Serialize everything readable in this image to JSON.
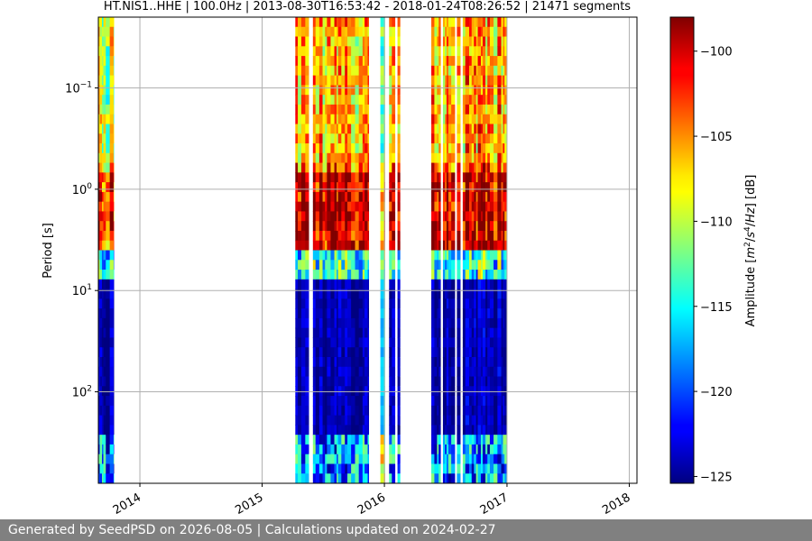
{
  "chart_data": {
    "type": "heatmap",
    "title": "HT.NIS1..HHE | 100.0Hz | 2013-08-30T16:53:42 - 2018-01-24T08:26:52 | 21471 segments",
    "ylabel": "Period [s]",
    "xlabel": "",
    "y_scale": "log",
    "ylim": [
      800,
      0.02
    ],
    "xlim": [
      "2013-08-30",
      "2018-01-24"
    ],
    "y_ticks": [
      {
        "value": 0.1,
        "base": "10",
        "exp": "−1"
      },
      {
        "value": 1,
        "base": "10",
        "exp": "0"
      },
      {
        "value": 10,
        "base": "10",
        "exp": "1"
      },
      {
        "value": 100,
        "base": "10",
        "exp": "2"
      }
    ],
    "x_ticks": [
      {
        "date": "2014-01-01",
        "label": "2014"
      },
      {
        "date": "2015-01-01",
        "label": "2015"
      },
      {
        "date": "2016-01-01",
        "label": "2016"
      },
      {
        "date": "2017-01-01",
        "label": "2017"
      },
      {
        "date": "2018-01-01",
        "label": "2018"
      }
    ],
    "grid": true,
    "colorbar": {
      "label": "Amplitude [m²/s⁴/Hz] [dB]",
      "range": [
        -125.4,
        -98
      ],
      "ticks": [
        -100,
        -105,
        -110,
        -115,
        -120,
        -125
      ],
      "colormap": "jet"
    },
    "data_periods": [
      {
        "start": "2013-08-30",
        "end": "2013-10-15",
        "low_period_db": -107,
        "high_period_db": -124
      },
      {
        "start": "2015-04-10",
        "end": "2015-11-15",
        "low_period_db": -104,
        "high_period_db": -124
      },
      {
        "start": "2015-12-20",
        "end": "2016-01-02",
        "low_period_db": -112,
        "high_period_db": -117
      },
      {
        "start": "2016-01-15",
        "end": "2016-02-20",
        "low_period_db": -103,
        "high_period_db": -123
      },
      {
        "start": "2016-05-20",
        "end": "2016-12-31",
        "low_period_db": -104,
        "high_period_db": -124
      }
    ]
  },
  "footer": {
    "text": "Generated by SeedPSD on 2026-08-05 | Calculations updated on 2024-02-27"
  }
}
